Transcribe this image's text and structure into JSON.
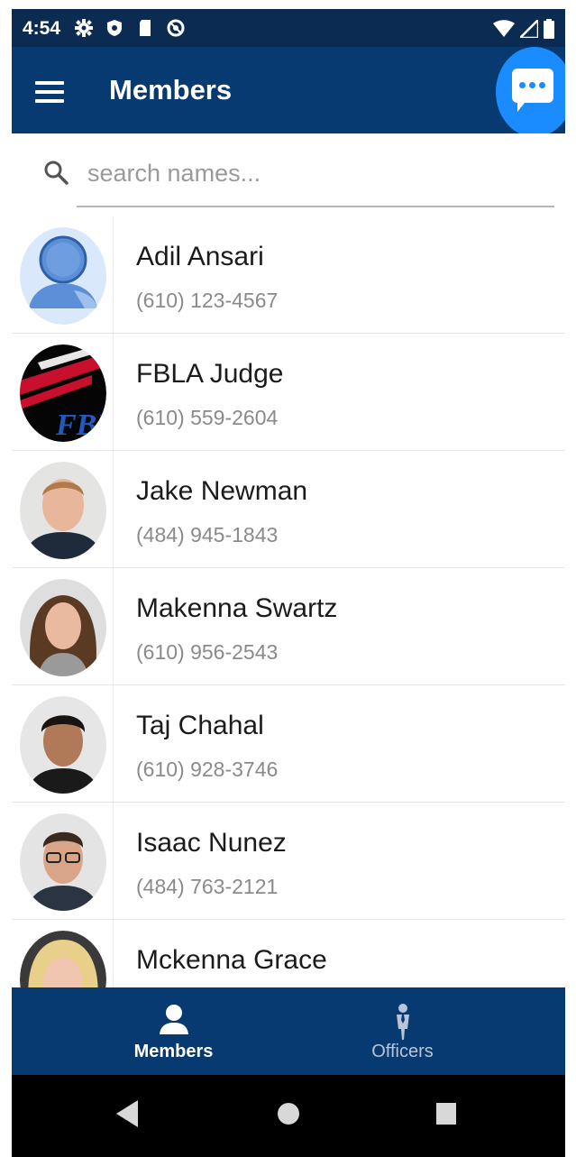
{
  "status_bar": {
    "time": "4:54",
    "icons": [
      "settings-gear-icon",
      "shield-icon",
      "sd-card-icon",
      "at-sign-icon"
    ],
    "right_icons": [
      "wifi-icon",
      "signal-icon",
      "battery-icon"
    ]
  },
  "app_bar": {
    "title": "Members",
    "menu_icon": "hamburger-menu-icon",
    "chat_icon": "chat-bubble-icon",
    "accent_color": "#073a70",
    "fab_color": "#1a8cff"
  },
  "search": {
    "placeholder": "search names...",
    "value": ""
  },
  "members": [
    {
      "name": "Adil Ansari",
      "phone": "(610) 123-4567",
      "avatar": "default-person-avatar"
    },
    {
      "name": "FBLA Judge",
      "phone": "(610) 559-2604",
      "avatar": "fbla-logo-avatar"
    },
    {
      "name": "Jake Newman",
      "phone": "(484) 945-1843",
      "avatar": "photo-avatar"
    },
    {
      "name": "Makenna Swartz",
      "phone": "(610) 956-2543",
      "avatar": "photo-avatar"
    },
    {
      "name": "Taj Chahal",
      "phone": "(610) 928-3746",
      "avatar": "photo-avatar"
    },
    {
      "name": "Isaac Nunez",
      "phone": "(484) 763-2121",
      "avatar": "photo-avatar"
    },
    {
      "name": "Mckenna Grace",
      "phone": "",
      "avatar": "photo-avatar"
    }
  ],
  "bottom_nav": {
    "items": [
      {
        "label": "Members",
        "icon": "person-icon",
        "active": true
      },
      {
        "label": "Officers",
        "icon": "officer-icon",
        "active": false
      }
    ]
  },
  "system_nav": {
    "buttons": [
      "back-icon",
      "home-icon",
      "recents-icon"
    ]
  }
}
